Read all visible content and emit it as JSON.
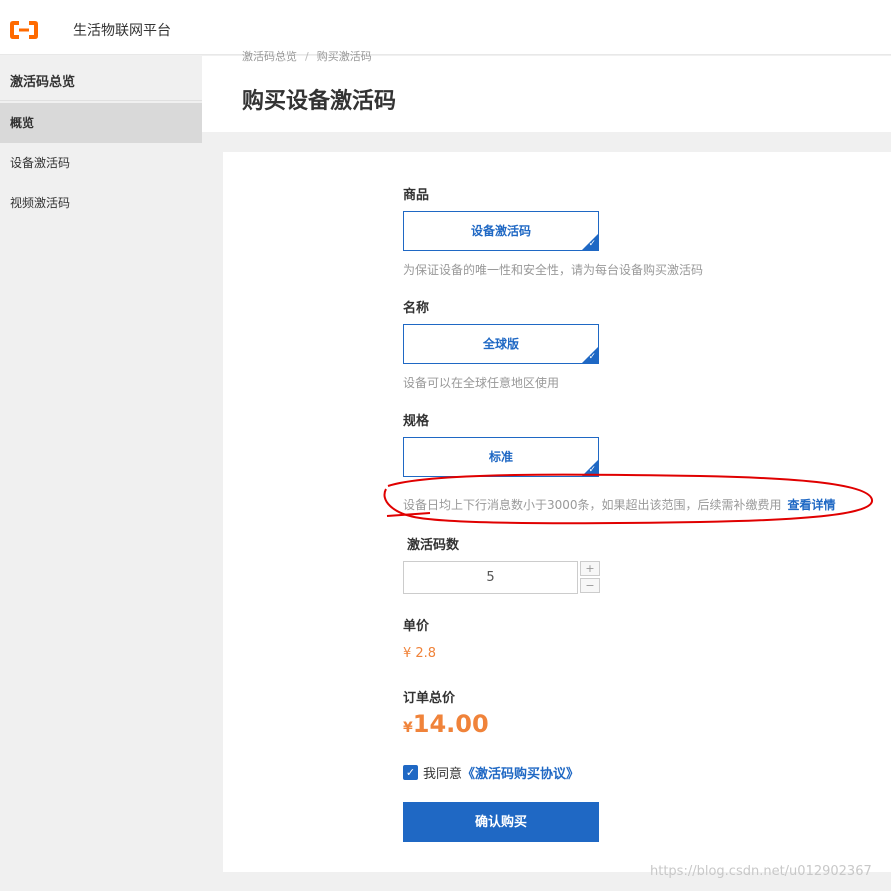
{
  "app": {
    "title": "生活物联网平台"
  },
  "sidebar": {
    "heading": "激活码总览",
    "items": [
      {
        "label": "概览"
      },
      {
        "label": "设备激活码"
      },
      {
        "label": "视频激活码"
      }
    ]
  },
  "header": {
    "breadcrumb": [
      "激活码总览",
      "购买激活码"
    ],
    "title": "购买设备激活码"
  },
  "form": {
    "product": {
      "label": "商品",
      "option": "设备激活码",
      "hint": "为保证设备的唯一性和安全性，请为每台设备购买激活码"
    },
    "name": {
      "label": "名称",
      "option": "全球版",
      "hint": "设备可以在全球任意地区使用"
    },
    "spec": {
      "label": "规格",
      "option": "标准",
      "hint": "设备日均上下行消息数小于3000条，如果超出该范围，后续需补缴费用",
      "link": "查看详情"
    },
    "quantity": {
      "label": "激活码数",
      "value": "5",
      "plus": "+",
      "minus": "−"
    },
    "unit_price": {
      "label": "单价",
      "value": "¥ 2.8"
    },
    "total": {
      "label": "订单总价",
      "currency": "¥",
      "value": "14.00"
    },
    "agreement": {
      "checked": true,
      "prefix": "我同意",
      "link": "《激活码购买协议》"
    },
    "submit_label": "确认购买"
  },
  "colors": {
    "accent": "#1f68c4",
    "price": "#f0833a",
    "annotation": "#e00000"
  },
  "watermark": "https://blog.csdn.net/u012902367"
}
